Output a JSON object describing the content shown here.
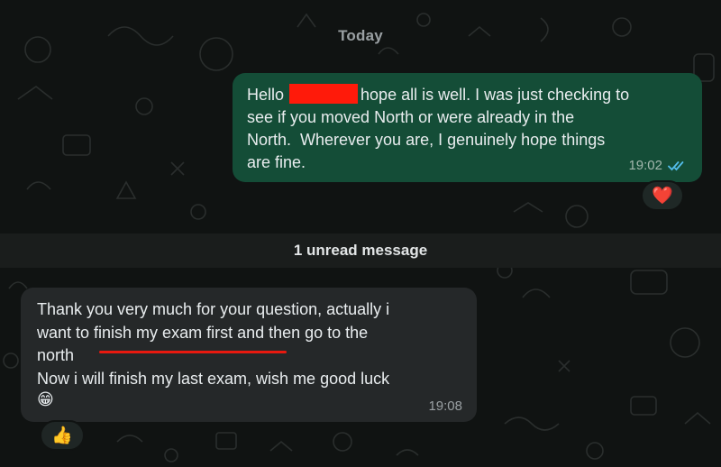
{
  "date_separator": "Today",
  "outgoing": {
    "greeting": "Hello",
    "text_after_redaction": "hope all is well. I was just checking to\nsee if you moved North or were already in the\nNorth.  Wherever you are, I genuinely hope things\nare fine.",
    "time": "19:02",
    "status_icon": "double-check-read-icon",
    "reaction": "❤️"
  },
  "unread_banner": "1 unread message",
  "incoming": {
    "text": "Thank you very much for your question, actually i\nwant to finish my exam first and then go to the\nnorth\nNow i will finish my last exam, wish me good luck",
    "emoji": "😁",
    "time": "19:08",
    "reaction": "👍"
  },
  "colors": {
    "background": "#101312",
    "outgoing_bubble": "#144d37",
    "incoming_bubble": "#252829",
    "read_ticks": "#53bdeb",
    "redaction": "#ff1a0a",
    "annotation_underline": "#e8190f"
  }
}
